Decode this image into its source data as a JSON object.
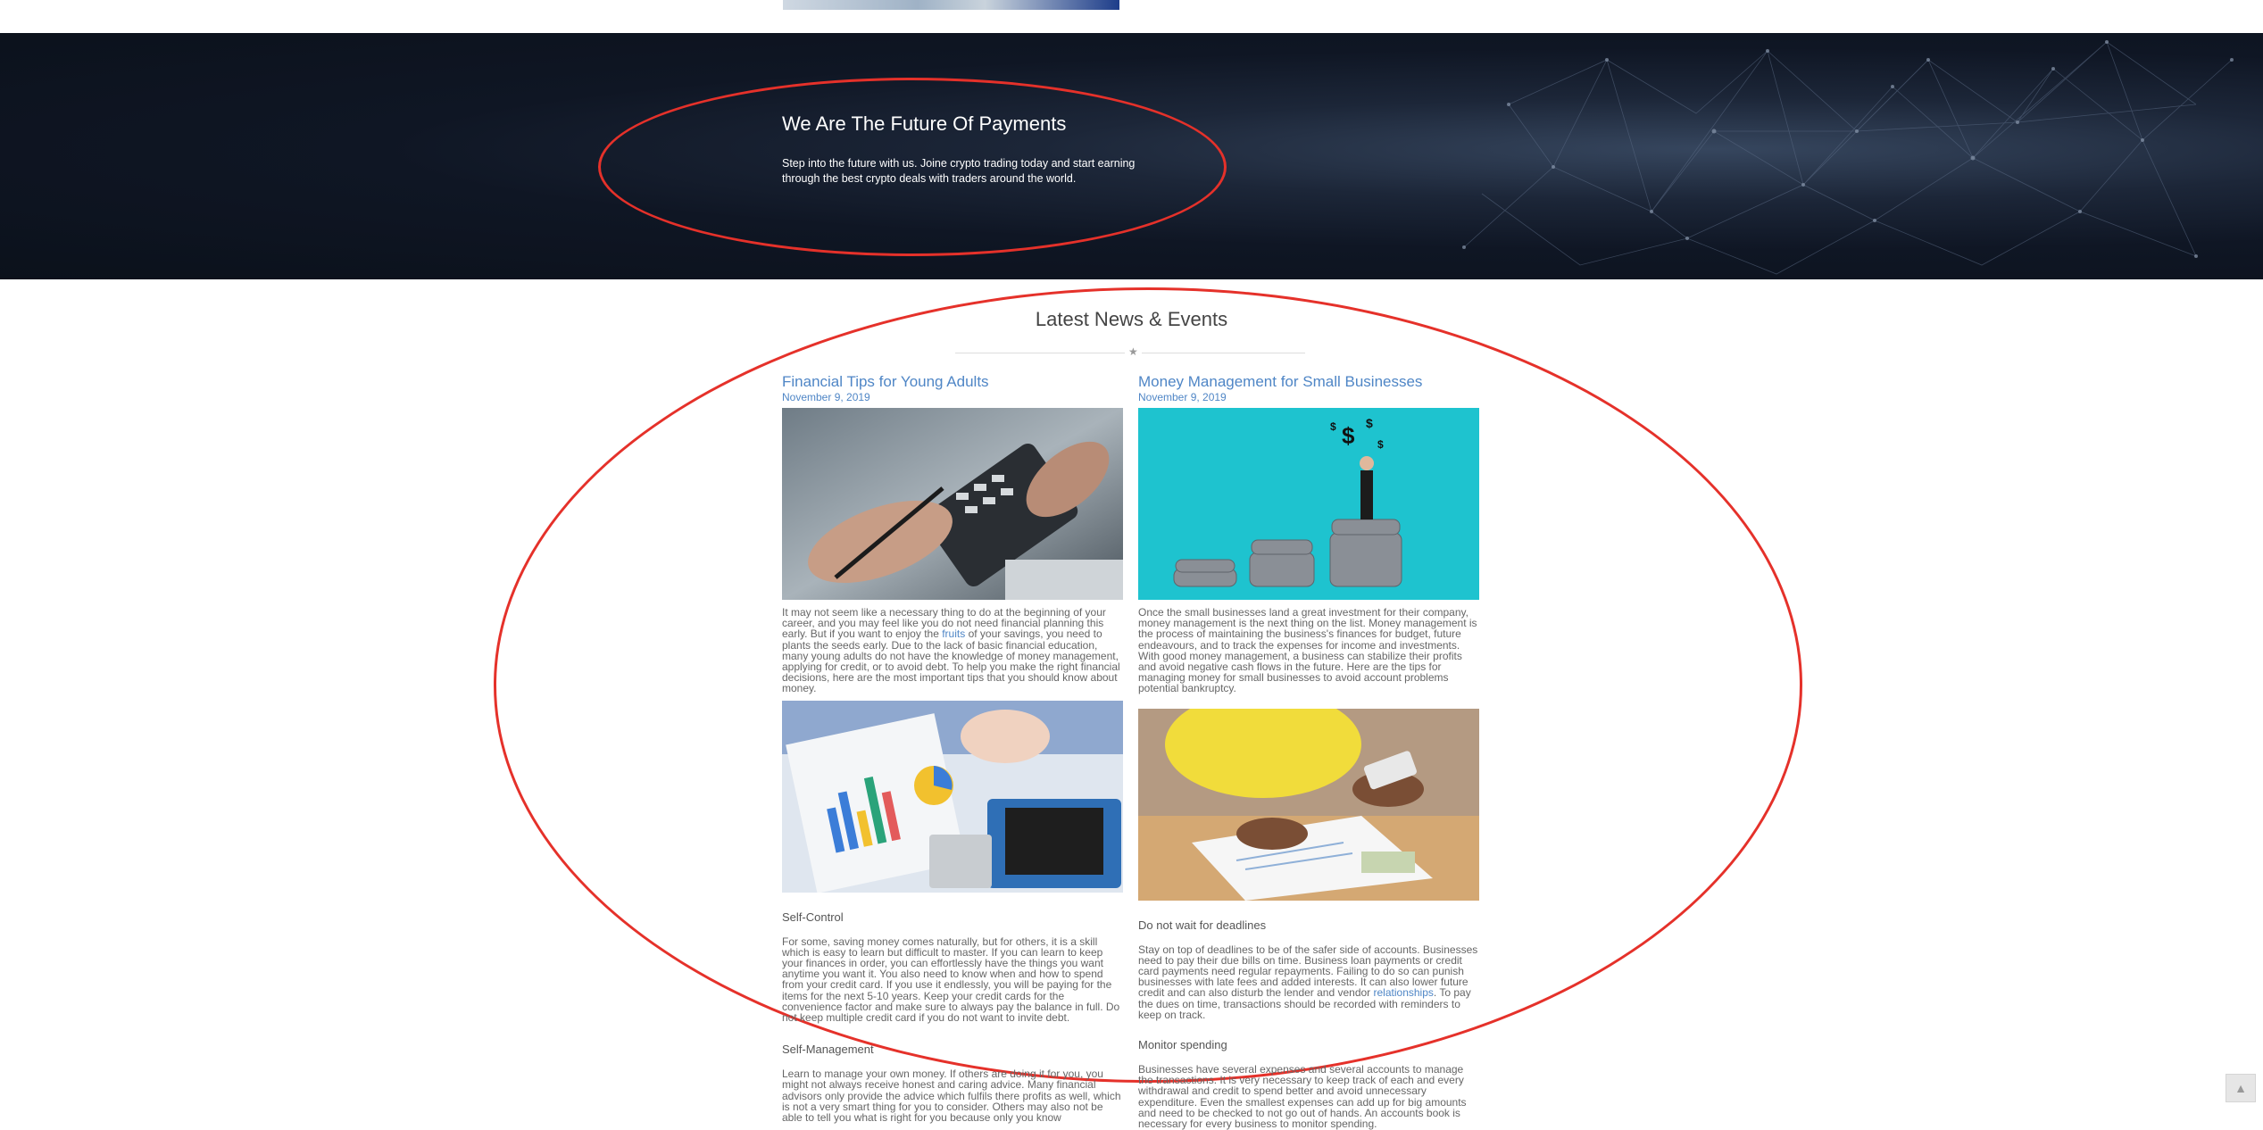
{
  "banner": {
    "title": "We Are The Future Of Payments",
    "text": "Step into the future with us. Joine crypto trading today and start earning through the best crypto deals with traders around the world."
  },
  "news": {
    "section_title": "Latest News & Events",
    "posts": [
      {
        "title": "Financial Tips for Young Adults",
        "date": "November 9, 2019",
        "excerpt_before": "It may not seem like a necessary thing to do at the beginning of your career, and you may feel like you do not need financial planning this early. But if you want to enjoy the ",
        "excerpt_link": "fruits",
        "excerpt_after": " of your savings, you need to plants the seeds early. Due to the lack of basic financial education, many young adults do not have the knowledge of money management, applying for credit, or to avoid debt. To help you make the right financial decisions, here are the most important tips that you should know about money.",
        "sections": [
          {
            "heading": "Self-Control",
            "text": "For some, saving money comes naturally, but for others, it is a skill which is easy to learn but difficult to master. If you can learn to keep your finances in order, you can effortlessly have the things you want anytime you want it. You also need to know when and how to spend from your credit card. If you use it endlessly, you will be paying for the items for the next 5-10 years. Keep your credit cards for the convenience factor and make sure to always pay the balance in full. Do not keep multiple credit card if you do not want to invite debt."
          },
          {
            "heading": "Self-Management",
            "text": "Learn to manage your own money. If others are doing it for you, you might not always receive honest and caring advice. Many financial advisors only provide the advice which fulfils there profits as well, which is not a very smart thing for you to consider. Others may also not be able to tell you what is right for you because only you know"
          }
        ]
      },
      {
        "title": "Money Management for Small Businesses",
        "date": "November 9, 2019",
        "excerpt_before": "Once the small businesses land a great investment for their company, money management is the next thing on the list. Money management is the process of maintaining the business's finances for budget, future endeavours, and to track the expenses for income and investments. With good money management, a business can stabilize their profits and avoid negative cash flows in the future. Here are the tips for managing money for small businesses to avoid account problems potential bankruptcy.",
        "excerpt_link": "",
        "excerpt_after": "",
        "sections": [
          {
            "heading": "Do not wait for deadlines",
            "text_before": "Stay on top of deadlines to be of the safer side of accounts. Businesses need to pay their due bills on time. Business loan payments or credit card payments need regular repayments. Failing to do so can punish businesses with late fees and added interests. It can also lower future credit and can also disturb the lender and vendor ",
            "text_link": "relationships",
            "text_after": ". To pay the dues on time, transactions should be recorded with reminders to keep on track."
          },
          {
            "heading": "Monitor spending",
            "text": "Businesses have several expenses and several accounts to manage the transactions. It is very necessary to keep track of each and every withdrawal and credit to spend better and avoid unnecessary expenditure. Even the smallest expenses can add up for big amounts and need to be checked to not go out of hands. An accounts book is necessary for every business to monitor spending."
          }
        ]
      }
    ]
  },
  "scroll_top_icon": "chevron-up-icon",
  "annotation_color": "#e5312a"
}
